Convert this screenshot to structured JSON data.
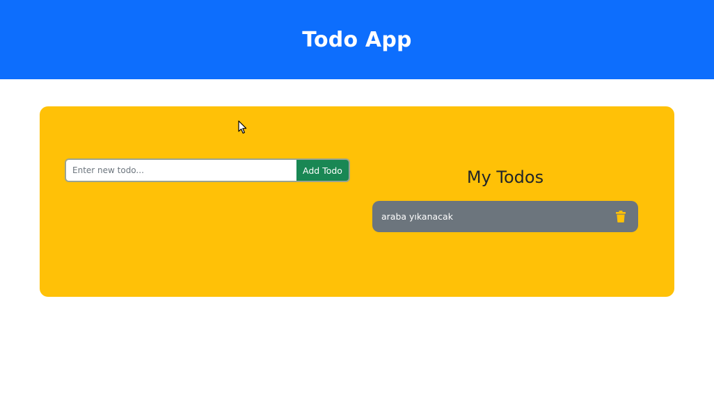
{
  "app": {
    "title": "Todo App"
  },
  "form": {
    "input_value": "",
    "input_placeholder": "Enter new todo...",
    "add_label": "Add Todo"
  },
  "list": {
    "title": "My Todos",
    "items": [
      {
        "text": "araba yıkanacak",
        "action_icon": "trash-icon"
      }
    ]
  },
  "colors": {
    "header_bg": "#0d6efd",
    "panel_bg": "#ffc107",
    "add_button_bg": "#198754",
    "todo_item_bg": "#6c757d",
    "trash_icon": "#ffc107"
  }
}
